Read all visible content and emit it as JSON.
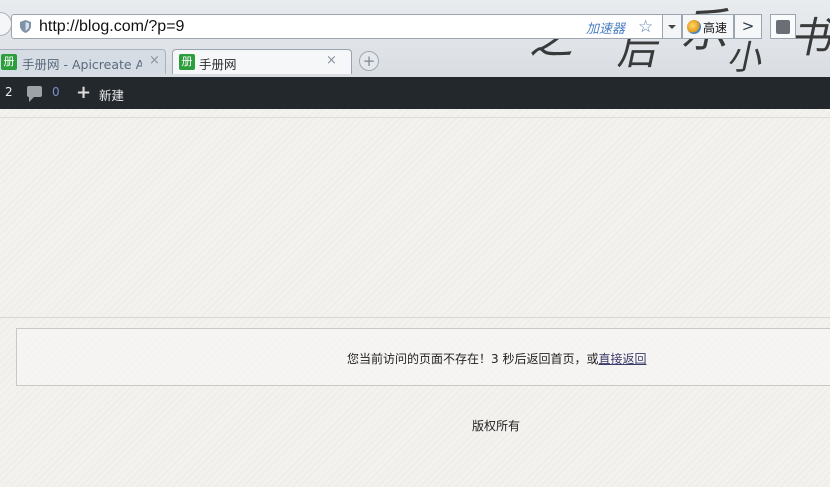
{
  "browser": {
    "url": "http://blog.com/?p=9",
    "accelerator_label": "加速器",
    "speed_label": "高速",
    "go_glyph": ">",
    "tabs": [
      {
        "title": "手册网 - Apicreate Api",
        "favicon": "册"
      },
      {
        "title": "手册网",
        "favicon": "册"
      }
    ],
    "close_glyph": "×",
    "newtab_glyph": "+"
  },
  "adminbar": {
    "count": "2",
    "comments": "0",
    "new_label": "新建"
  },
  "page": {
    "notice_prefix": "您当前访问的页面不存在！3 秒后返回首页，或",
    "notice_link": "直接返回",
    "footer": "版权所有"
  }
}
